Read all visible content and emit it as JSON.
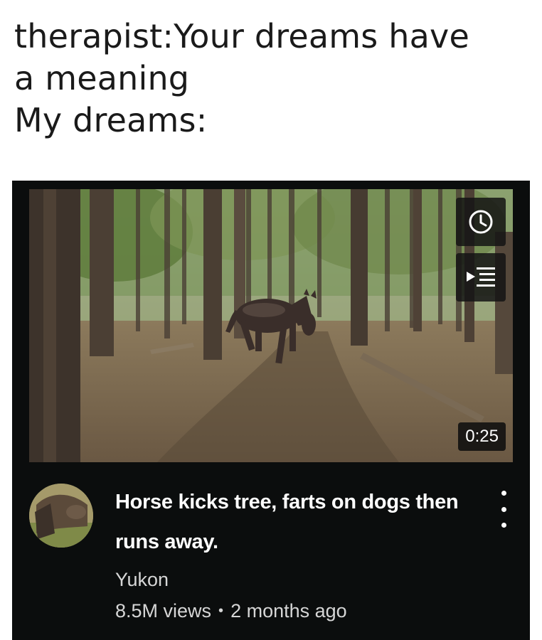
{
  "caption": {
    "line1": "therapist:Your dreams have",
    "line2": "a meaning",
    "line3": "My dreams:"
  },
  "video": {
    "duration": "0:25",
    "title": "Horse kicks tree, farts on dogs then runs away.",
    "channel": "Yukon",
    "views": "8.5M views",
    "separator": "•",
    "age": "2 months ago",
    "icons": {
      "watch_later": "clock-icon",
      "add_to_queue": "queue-icon",
      "more": "more-vert-icon"
    }
  },
  "colors": {
    "card_background": "#0b0d0d",
    "title_text": "#ffffff",
    "meta_text": "#d6d6d6",
    "caption_text": "#1a1a1a"
  }
}
